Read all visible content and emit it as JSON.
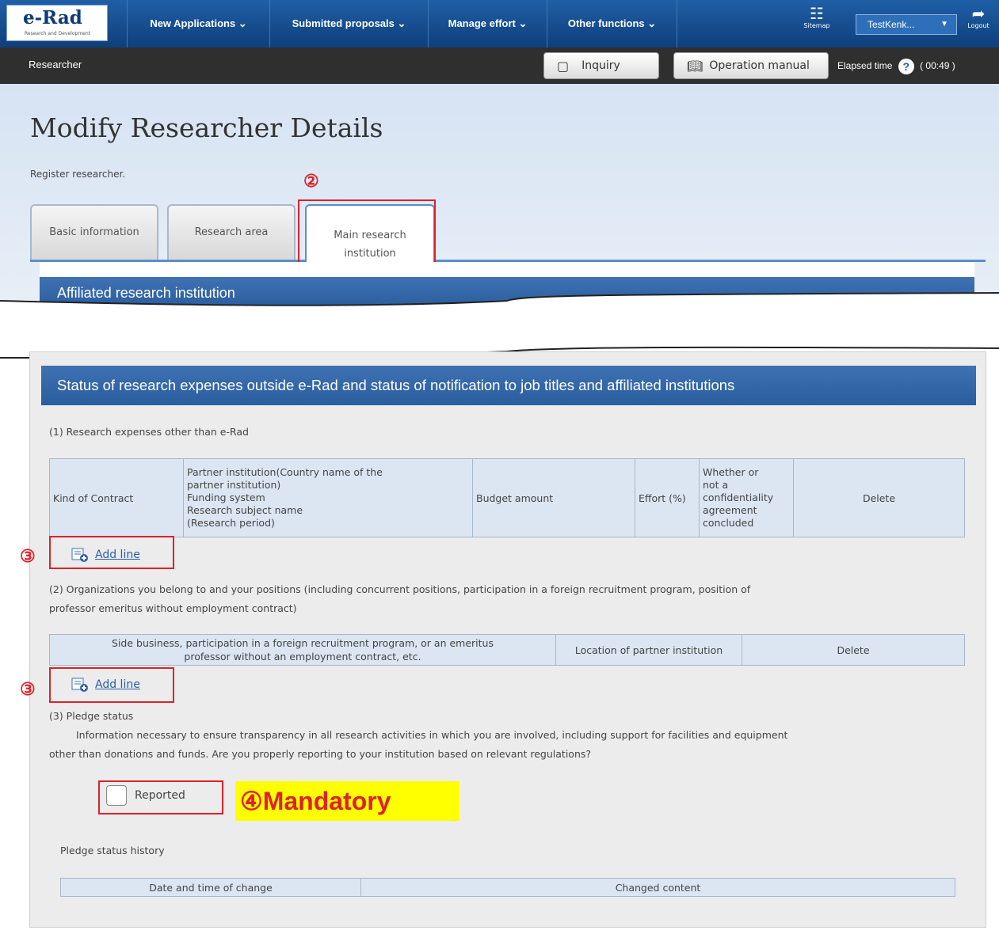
{
  "header": {
    "logo_text": "e-Rad",
    "logo_sub": "Research and Development",
    "nav": [
      "New Applications ⌄",
      "Submitted proposals ⌄",
      "Manage effort ⌄",
      "Other functions ⌄"
    ],
    "sitemap_label": "Sitemap",
    "user": "TestKenk...",
    "logout_label": "Logout"
  },
  "subbar": {
    "role": "Researcher",
    "inquiry": "Inquiry",
    "manual": "Operation manual",
    "elapsed_label": "Elapsed time",
    "elapsed_value": "( 00:49 )"
  },
  "page": {
    "title": "Modify Researcher Details",
    "subtitle": "Register researcher.",
    "tabs": [
      "Basic information",
      "Research area",
      "Main research institution"
    ],
    "callout_2": "②",
    "affiliated_header": "Affiliated research institution"
  },
  "status": {
    "header": "Status of research expenses outside e-Rad and status of notification to job titles and affiliated institutions",
    "s1_title": "(1) Research expenses other than e-Rad",
    "t1_headers": {
      "kind": "Kind of Contract",
      "partner_l1": "Partner institution(Country name of the",
      "partner_l2": "partner institution)",
      "partner_l3": "Funding system",
      "partner_l4": "Research subject name",
      "partner_l5": "(Research period)",
      "budget": "Budget amount",
      "effort": "Effort (%)",
      "conf_l1": "Whether or",
      "conf_l2": "not a",
      "conf_l3": "confidentiality",
      "conf_l4": "agreement",
      "conf_l5": "concluded",
      "delete": "Delete"
    },
    "add_line": "Add line",
    "callout_3": "③",
    "s2_title_l1": "(2) Organizations you belong to and your positions (including concurrent positions, participation in a foreign recruitment program, position of",
    "s2_title_l2": "professor emeritus without employment contract)",
    "t2_headers": {
      "side_l1": "Side business, participation in a foreign recruitment program, or an emeritus",
      "side_l2": "professor without an employment contract, etc.",
      "location": "Location of partner institution",
      "delete": "Delete"
    },
    "s3_title": "(3) Pledge status",
    "s3_text_l1": "Information necessary to ensure transparency in all research activities in which you are involved, including support for facilities and equipment",
    "s3_text_l2": "other than donations and funds. Are you properly reporting to your institution based on relevant regulations?",
    "reported_label": "Reported",
    "mandatory_note": "④Mandatory",
    "history_title": "Pledge status history",
    "history_headers": {
      "date": "Date and time of change",
      "content": "Changed content"
    }
  },
  "colors": {
    "nav_blue": "#1f5fa6",
    "annotation_red": "#e0202a",
    "highlight_yellow": "#ffff00"
  },
  "icons": [
    "sitemap-icon",
    "logout-icon",
    "inquiry-icon",
    "manual-icon",
    "help-icon",
    "add-line-icon"
  ]
}
